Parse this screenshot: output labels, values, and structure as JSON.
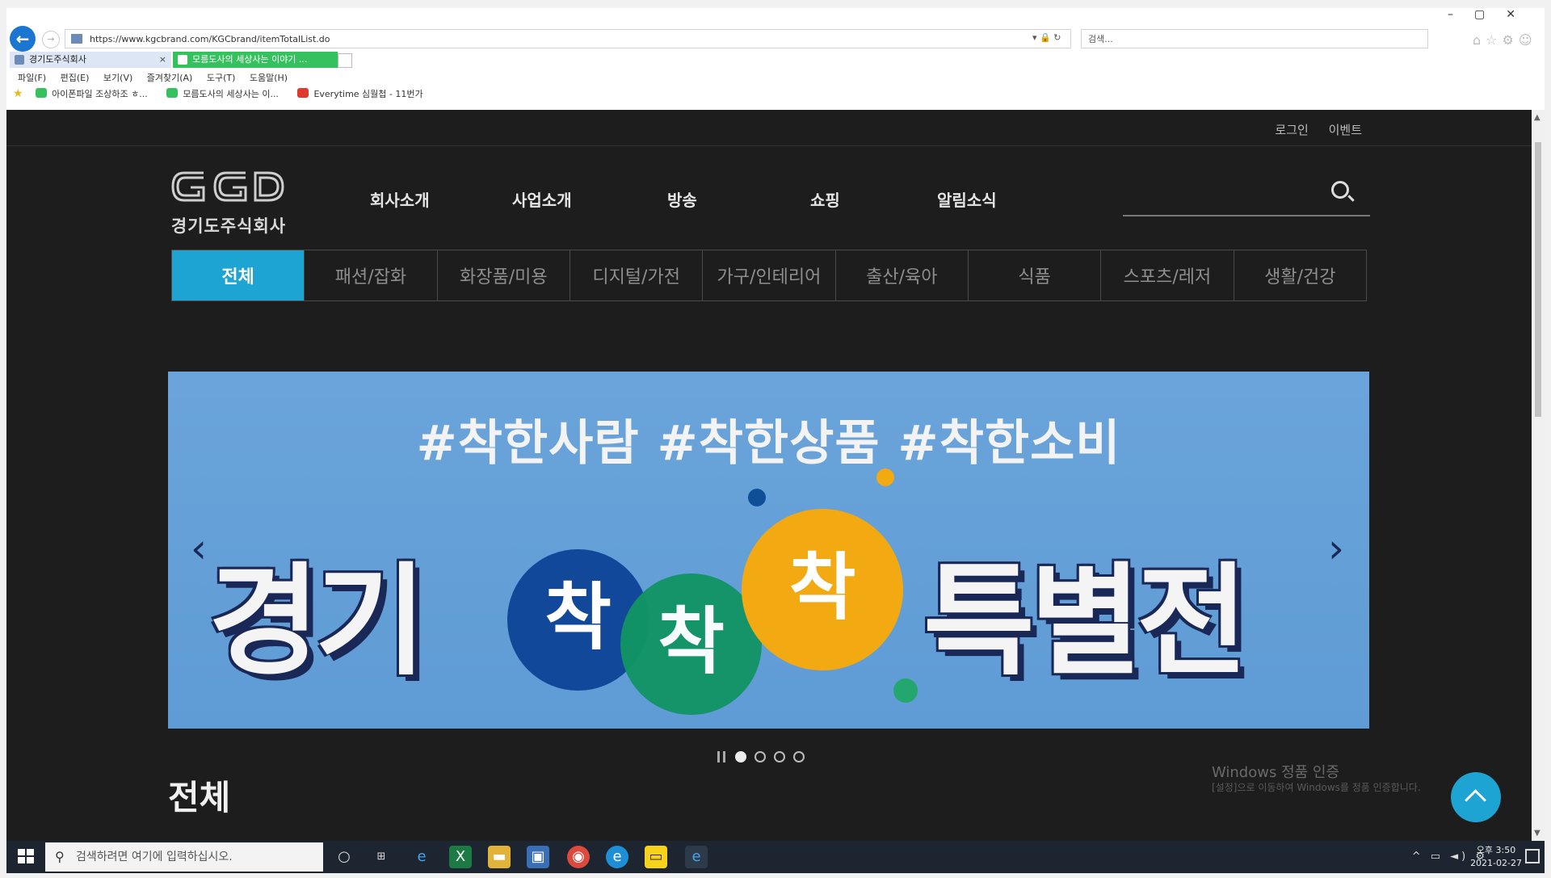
{
  "browser": {
    "url": "https://www.kgcbrand.com/KGCbrand/itemTotalList.do",
    "search_placeholder": "검색...",
    "tabs": [
      {
        "label": "경기도주식회사"
      },
      {
        "label": "모름도사의 세상사는 이야기 ..."
      }
    ],
    "menu": "파일(F)  편집(E)  보기(V)  즐겨찾기(A)  도구(T)  도움말(H)",
    "favorites": [
      {
        "label": "아이폰파일 조상하조 ㅎ...",
        "color": "#35c25e"
      },
      {
        "label": "모름도사의 세상사는 이...",
        "color": "#35c25e"
      },
      {
        "label": "Everytime 심월첩 - 11번가",
        "color": "#e03a2f"
      }
    ]
  },
  "site": {
    "top_links": [
      "로그인",
      "이벤트"
    ],
    "logo_text": "경기도주식회사",
    "nav": [
      "회사소개",
      "사업소개",
      "방송",
      "쇼핑",
      "알림소식"
    ],
    "categories": [
      {
        "label": "전체",
        "active": true
      },
      {
        "label": "패션/잡화",
        "active": false
      },
      {
        "label": "화장품/미용",
        "active": false
      },
      {
        "label": "디지털/가전",
        "active": false
      },
      {
        "label": "가구/인테리어",
        "active": false
      },
      {
        "label": "출산/육아",
        "active": false
      },
      {
        "label": "식품",
        "active": false
      },
      {
        "label": "스포츠/레저",
        "active": false
      },
      {
        "label": "생활/건강",
        "active": false
      }
    ],
    "banner": {
      "hashtags": "#착한사람 #착한상품 #착한소비",
      "word_left": "경기",
      "bubbles": [
        "착",
        "착",
        "착"
      ],
      "word_right": "특별전"
    },
    "slider_dots": 4,
    "slider_active": 1,
    "section_title": "전체",
    "accent_color": "#1ea4d2"
  },
  "watermark": {
    "line1": "Windows 정품 인증",
    "line2": "[설정]으로 이동하여 Windows를 정품 인증합니다."
  },
  "taskbar": {
    "search_placeholder": "검색하려면 여기에 입력하십시오.",
    "clock_time": "오후 3:50",
    "clock_date": "2021-02-27"
  }
}
